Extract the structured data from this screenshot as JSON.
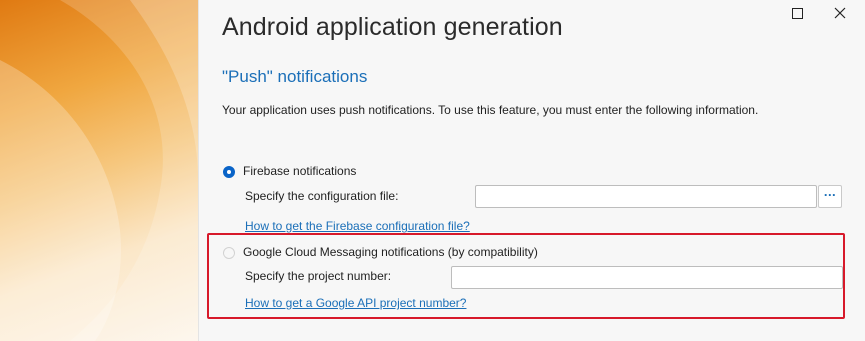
{
  "window": {
    "title": "Android application generation"
  },
  "section": {
    "heading": "\"Push\" notifications",
    "description": "Your application uses push notifications. To use this feature, you must enter the following information."
  },
  "firebase": {
    "option_label": "Firebase notifications",
    "selected": true,
    "config_label": "Specify the configuration file:",
    "config_value": "",
    "browse_label": "...",
    "help_link": "How to get the Firebase configuration file?"
  },
  "gcm": {
    "option_label": "Google Cloud Messaging notifications (by compatibility)",
    "selected": false,
    "project_label": "Specify the project number:",
    "project_value": "",
    "help_link": "How to get a Google API project number?"
  },
  "colors": {
    "accent": "#1b6fb8",
    "highlight": "#d7192a",
    "radio_selected": "#0a64c8"
  },
  "icons": [
    "maximize-icon",
    "close-icon"
  ]
}
